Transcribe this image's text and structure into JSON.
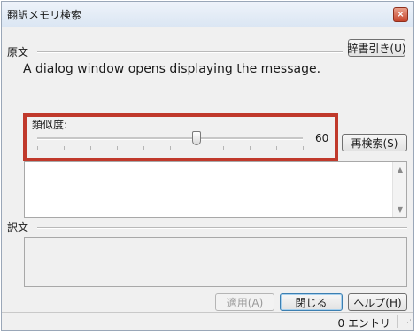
{
  "window": {
    "title": "翻訳メモリ検索",
    "close_symbol": "×"
  },
  "source": {
    "label": "原文",
    "text": "A dialog window opens displaying the message.",
    "dictionary_button": "辞書引き(U)"
  },
  "similarity": {
    "label": "類似度:",
    "value": 60,
    "value_text": "60",
    "min": 0,
    "max": 100,
    "research_button": "再検索(S)",
    "highlight_color": "#c0392b"
  },
  "translation": {
    "label": "訳文"
  },
  "buttons": {
    "apply": "適用(A)",
    "close": "閉じる",
    "help": "ヘルプ(H)"
  },
  "status": {
    "entries": "0 エントリ"
  },
  "icons": {
    "close": "close-icon",
    "scroll_up": "arrow-up-icon",
    "scroll_down": "arrow-down-icon",
    "resize": "resize-grip-icon"
  }
}
